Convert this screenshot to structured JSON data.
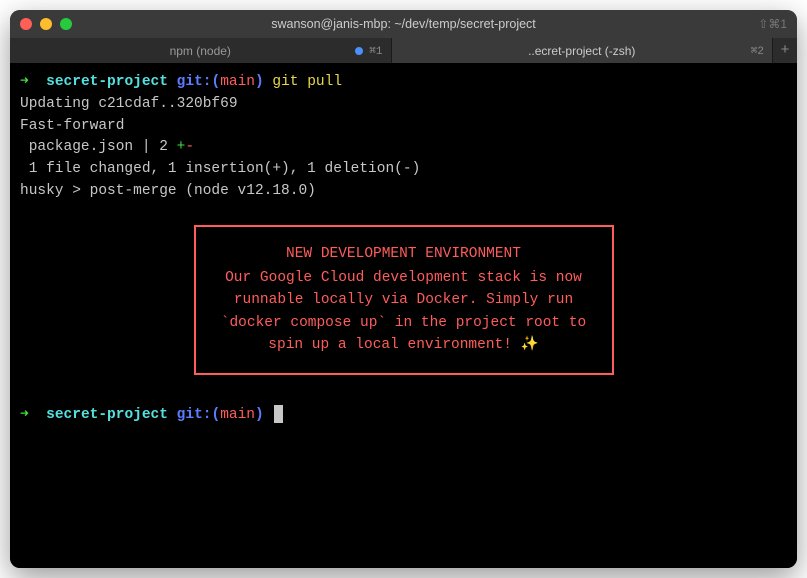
{
  "titlebar": {
    "title": "swanson@janis-mbp: ~/dev/temp/secret-project",
    "right_shortcut": "⇧⌘1"
  },
  "tabs": [
    {
      "label": "npm (node)",
      "shortcut": "⌘1",
      "has_dot": true
    },
    {
      "label": "..ecret-project (-zsh)",
      "shortcut": "⌘2",
      "has_dot": false
    }
  ],
  "output": {
    "prompt_arrow": "➜ ",
    "project": "secret-project",
    "git_prefix": "git:(",
    "branch": "main",
    "git_suffix": ")",
    "command": "git pull",
    "line_update": "Updating c21cdaf..320bf69",
    "line_ff": "Fast-forward",
    "line_pkg_file": " package.json | 2 ",
    "line_pkg_plus": "+",
    "line_pkg_minus": "-",
    "line_summary": " 1 file changed, 1 insertion(+), 1 deletion(-)",
    "line_husky": "husky > post-merge (node v12.18.0)"
  },
  "announcement": {
    "title": "NEW DEVELOPMENT ENVIRONMENT",
    "body": "Our Google Cloud development stack is now runnable locally via Docker. Simply run `docker compose up` in the project root to spin up a local environment! ✨"
  }
}
